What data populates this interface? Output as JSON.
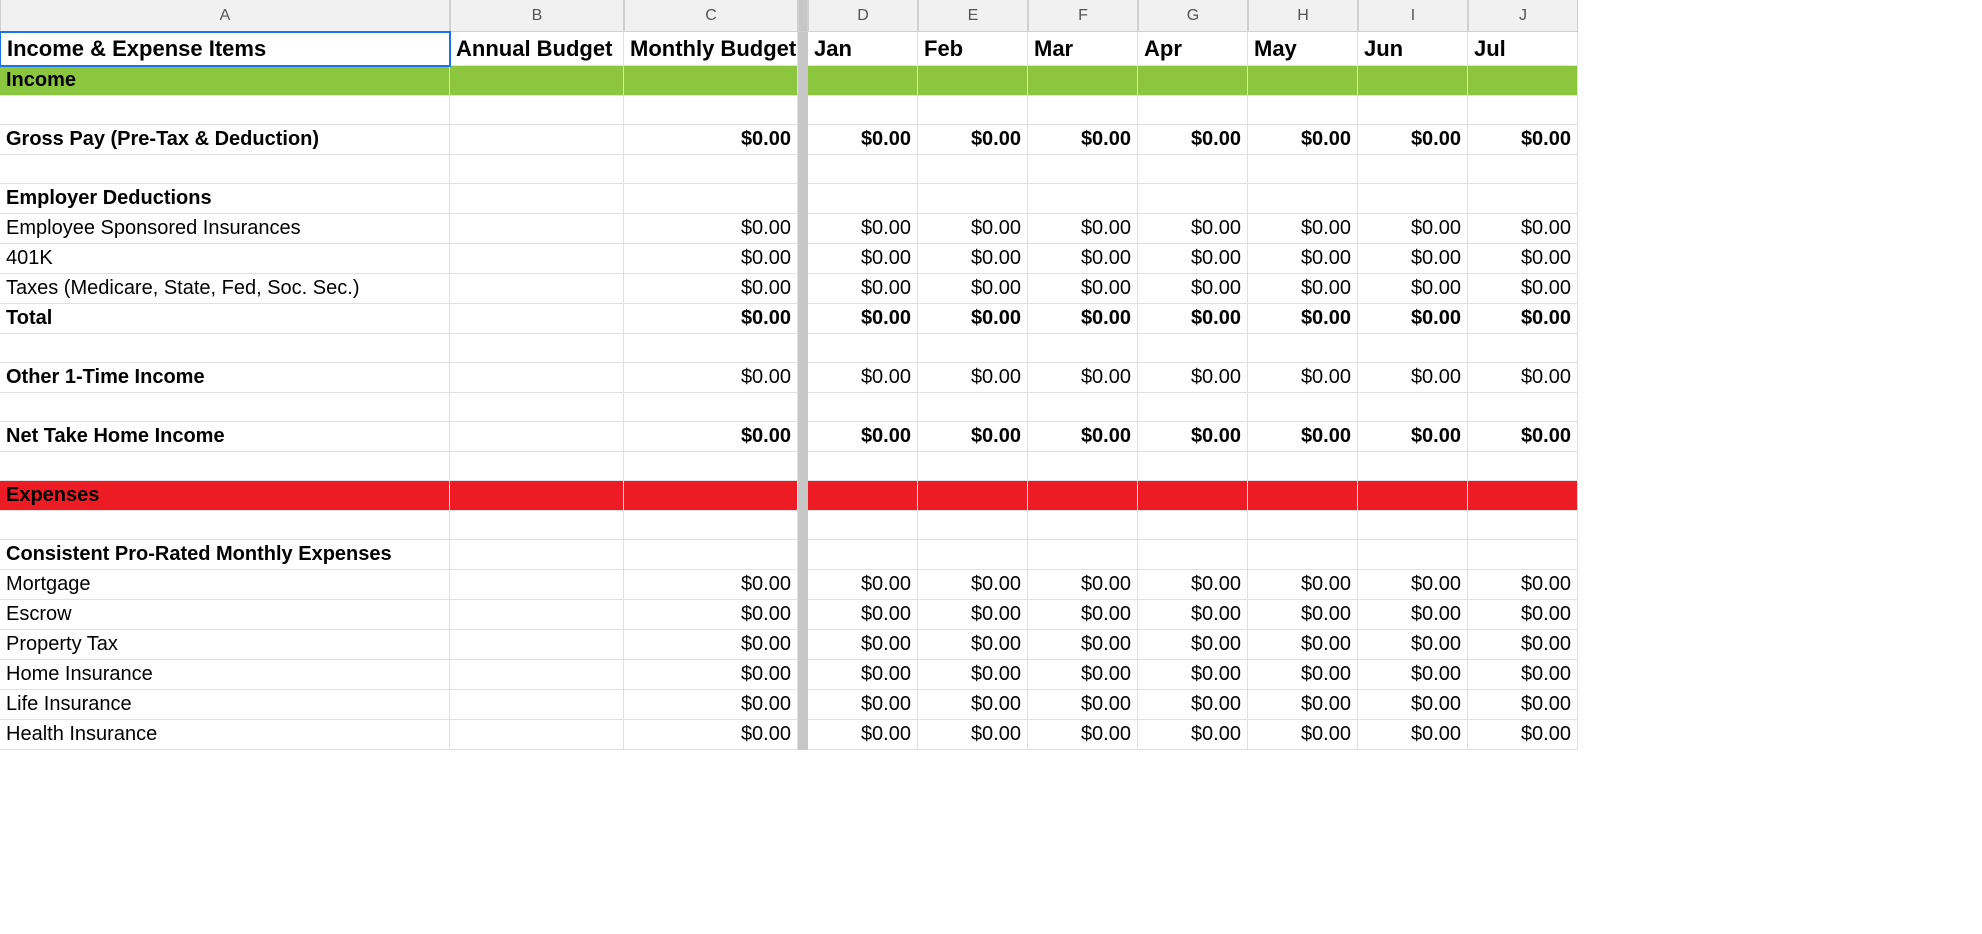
{
  "columns": [
    "A",
    "B",
    "C",
    "D",
    "E",
    "F",
    "G",
    "H",
    "I",
    "J"
  ],
  "headers": {
    "A": "Income & Expense Items",
    "B": "Annual Budget",
    "C": "Monthly Budget",
    "D": "Jan",
    "E": "Feb",
    "F": "Mar",
    "G": "Apr",
    "H": "May",
    "I": "Jun",
    "J": "Jul"
  },
  "rows": [
    {
      "type": "section-income",
      "label": "Income"
    },
    {
      "type": "blank"
    },
    {
      "type": "data",
      "bold": true,
      "label": "Gross Pay (Pre-Tax & Deduction)",
      "B": "",
      "C": "$0.00",
      "months": [
        "$0.00",
        "$0.00",
        "$0.00",
        "$0.00",
        "$0.00",
        "$0.00",
        "$0.00"
      ]
    },
    {
      "type": "blank"
    },
    {
      "type": "label",
      "bold": true,
      "label": "Employer Deductions"
    },
    {
      "type": "data",
      "bold": false,
      "label": "Employee Sponsored Insurances",
      "B": "",
      "C": "$0.00",
      "months": [
        "$0.00",
        "$0.00",
        "$0.00",
        "$0.00",
        "$0.00",
        "$0.00",
        "$0.00"
      ]
    },
    {
      "type": "data",
      "bold": false,
      "label": "401K",
      "B": "",
      "C": "$0.00",
      "months": [
        "$0.00",
        "$0.00",
        "$0.00",
        "$0.00",
        "$0.00",
        "$0.00",
        "$0.00"
      ]
    },
    {
      "type": "data",
      "bold": false,
      "label": "Taxes (Medicare, State, Fed, Soc. Sec.)",
      "B": "",
      "C": "$0.00",
      "months": [
        "$0.00",
        "$0.00",
        "$0.00",
        "$0.00",
        "$0.00",
        "$0.00",
        "$0.00"
      ]
    },
    {
      "type": "data",
      "bold": true,
      "label": "Total",
      "B": "",
      "C": "$0.00",
      "months": [
        "$0.00",
        "$0.00",
        "$0.00",
        "$0.00",
        "$0.00",
        "$0.00",
        "$0.00"
      ]
    },
    {
      "type": "blank"
    },
    {
      "type": "data",
      "bold": true,
      "labelBold": true,
      "valueBold": false,
      "label": "Other 1-Time Income",
      "B": "",
      "C": "$0.00",
      "months": [
        "$0.00",
        "$0.00",
        "$0.00",
        "$0.00",
        "$0.00",
        "$0.00",
        "$0.00"
      ]
    },
    {
      "type": "blank"
    },
    {
      "type": "data",
      "bold": true,
      "label": "Net Take Home Income",
      "B": "",
      "C": "$0.00",
      "months": [
        "$0.00",
        "$0.00",
        "$0.00",
        "$0.00",
        "$0.00",
        "$0.00",
        "$0.00"
      ]
    },
    {
      "type": "blank"
    },
    {
      "type": "section-expenses",
      "label": "Expenses"
    },
    {
      "type": "blank"
    },
    {
      "type": "label",
      "bold": true,
      "label": "Consistent Pro-Rated Monthly Expenses"
    },
    {
      "type": "data",
      "bold": false,
      "label": "Mortgage",
      "B": "",
      "C": "$0.00",
      "months": [
        "$0.00",
        "$0.00",
        "$0.00",
        "$0.00",
        "$0.00",
        "$0.00",
        "$0.00"
      ]
    },
    {
      "type": "data",
      "bold": false,
      "label": "Escrow",
      "B": "",
      "C": "$0.00",
      "months": [
        "$0.00",
        "$0.00",
        "$0.00",
        "$0.00",
        "$0.00",
        "$0.00",
        "$0.00"
      ]
    },
    {
      "type": "data",
      "bold": false,
      "label": "Property Tax",
      "B": "",
      "C": "$0.00",
      "months": [
        "$0.00",
        "$0.00",
        "$0.00",
        "$0.00",
        "$0.00",
        "$0.00",
        "$0.00"
      ]
    },
    {
      "type": "data",
      "bold": false,
      "label": "Home Insurance",
      "B": "",
      "C": "$0.00",
      "months": [
        "$0.00",
        "$0.00",
        "$0.00",
        "$0.00",
        "$0.00",
        "$0.00",
        "$0.00"
      ]
    },
    {
      "type": "data",
      "bold": false,
      "label": "Life Insurance",
      "B": "",
      "C": "$0.00",
      "months": [
        "$0.00",
        "$0.00",
        "$0.00",
        "$0.00",
        "$0.00",
        "$0.00",
        "$0.00"
      ]
    },
    {
      "type": "data",
      "bold": false,
      "label": "Health Insurance",
      "B": "",
      "C": "$0.00",
      "months": [
        "$0.00",
        "$0.00",
        "$0.00",
        "$0.00",
        "$0.00",
        "$0.00",
        "$0.00"
      ]
    }
  ]
}
